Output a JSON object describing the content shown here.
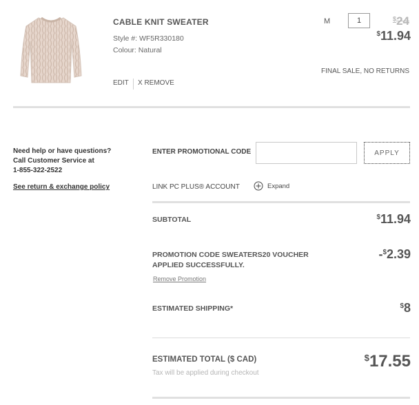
{
  "product": {
    "image_icon": "sweater-image",
    "name": "CABLE KNIT SWEATER",
    "style_label": "Style #:",
    "style_value": "WF5R330180",
    "colour_label": "Colour:",
    "colour_value": "Natural",
    "size": "M",
    "quantity": "1",
    "currency_symbol": "$",
    "original_price": "24",
    "sale_price": "11.94",
    "edit_label": "EDIT",
    "remove_label": "X REMOVE",
    "final_sale_note": "FINAL SALE, NO RETURNS"
  },
  "help": {
    "line1": "Need help or have questions?",
    "line2": "Call Customer Service at",
    "phone": "1-855-322-2522",
    "policy_link": "See return & exchange policy"
  },
  "promo": {
    "label": "ENTER PROMOTIONAL CODE",
    "input_value": "",
    "apply_label": "APPLY",
    "pc_plus_label": "LINK PC PLUS® ACCOUNT",
    "expand_label": "Expand"
  },
  "summary": {
    "subtotal_label": "SUBTOTAL",
    "subtotal_value": "11.94",
    "promotion_line1": "PROMOTION CODE SWEATERS20 VOUCHER",
    "promotion_line2": "APPLIED SUCCESSFULLY.",
    "promotion_sign": "-",
    "promotion_value": "2.39",
    "remove_promotion": "Remove Promotion",
    "shipping_label": "ESTIMATED SHIPPING*",
    "shipping_value": "8",
    "total_label": "ESTIMATED TOTAL ($ CAD)",
    "total_value": "17.55",
    "tax_note": "Tax will be applied during checkout"
  },
  "colors": {
    "text": "#555555",
    "divider": "#e0e0e0",
    "muted": "#b5b5b5"
  }
}
